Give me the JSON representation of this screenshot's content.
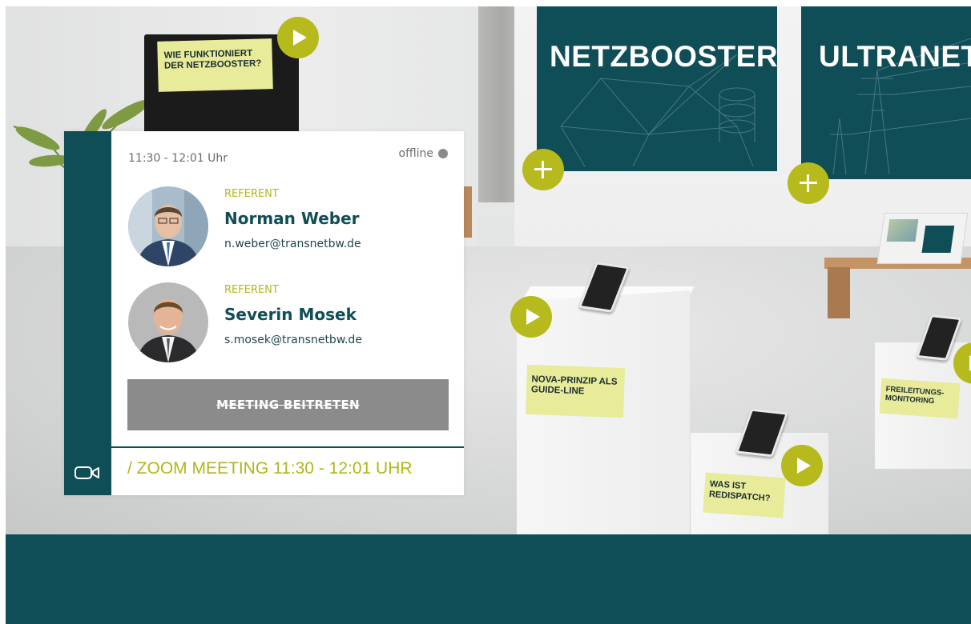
{
  "colors": {
    "brand_teal": "#0f4d57",
    "accent_olive": "#b3b51c",
    "hotspot": "#b7ba1c",
    "sticky_note": "#e7eb9a",
    "button_disabled": "#8b8b8b",
    "status_offline": "#8a8a8a"
  },
  "scene": {
    "banners": [
      {
        "title": "NETZBOOSTER"
      },
      {
        "title": "ULTRANET"
      }
    ],
    "monitor_label": "WIE FUNKTIONIERT DER NETZBOOSTER?",
    "stickies": {
      "nova": "NOVA-PRINZIP ALS GUIDE-LINE",
      "redispatch": "WAS IST REDISPATCH?",
      "freileitung": "FREILEITUNGS-MONITORING"
    },
    "hotspots": [
      {
        "icon": "play-icon"
      },
      {
        "icon": "plus-icon"
      },
      {
        "icon": "plus-icon"
      },
      {
        "icon": "play-icon"
      },
      {
        "icon": "play-icon"
      },
      {
        "icon": "play-icon"
      }
    ]
  },
  "card": {
    "time": "11:30 - 12:01 Uhr",
    "status": "offline",
    "speakers": [
      {
        "role": "REFERENT",
        "name": "Norman Weber",
        "email": "n.weber@transnetbw.de"
      },
      {
        "role": "REFERENT",
        "name": "Severin Mosek",
        "email": "s.mosek@transnetbw.de"
      }
    ],
    "join_label": "MEETING BEITRETEN",
    "meeting_label": "/ ZOOM MEETING 11:30 - 12:01 UHR",
    "meeting_icon": "video-camera-icon"
  }
}
